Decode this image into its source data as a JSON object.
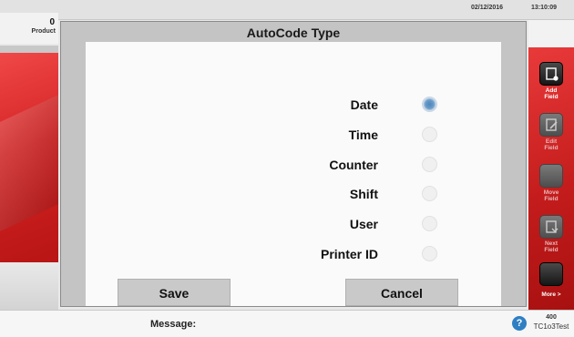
{
  "status": {
    "date": "02/12/2016",
    "time": "13:10:09"
  },
  "product": {
    "count": "0",
    "label": "Product"
  },
  "dialog": {
    "title": "AutoCode Type",
    "options": [
      {
        "label": "Date",
        "checked": true
      },
      {
        "label": "Time",
        "checked": false
      },
      {
        "label": "Counter",
        "checked": false
      },
      {
        "label": "Shift",
        "checked": false
      },
      {
        "label": "User",
        "checked": false
      },
      {
        "label": "Printer ID",
        "checked": false
      }
    ],
    "save_label": "Save",
    "cancel_label": "Cancel"
  },
  "tools": [
    {
      "label_1": "Add",
      "label_2": "Field",
      "icon": "add-field-icon",
      "enabled": true
    },
    {
      "label_1": "Edit",
      "label_2": "Field",
      "icon": "edit-field-icon",
      "enabled": false
    },
    {
      "label_1": "Move",
      "label_2": "Field",
      "icon": "move-field-icon",
      "enabled": false
    },
    {
      "label_1": "Next",
      "label_2": "Field",
      "icon": "next-field-icon",
      "enabled": false
    },
    {
      "label_1": "More",
      "label_2": ">",
      "icon": "more-icon",
      "enabled": true
    }
  ],
  "message": {
    "label": "Message:"
  },
  "footer": {
    "help_glyph": "?",
    "stat_value": "400",
    "stat_name": "TC1o3Test"
  },
  "colors": {
    "accent_red": "#d42323",
    "radio_selected": "#4d86b9",
    "help_blue": "#2f7fc3"
  }
}
